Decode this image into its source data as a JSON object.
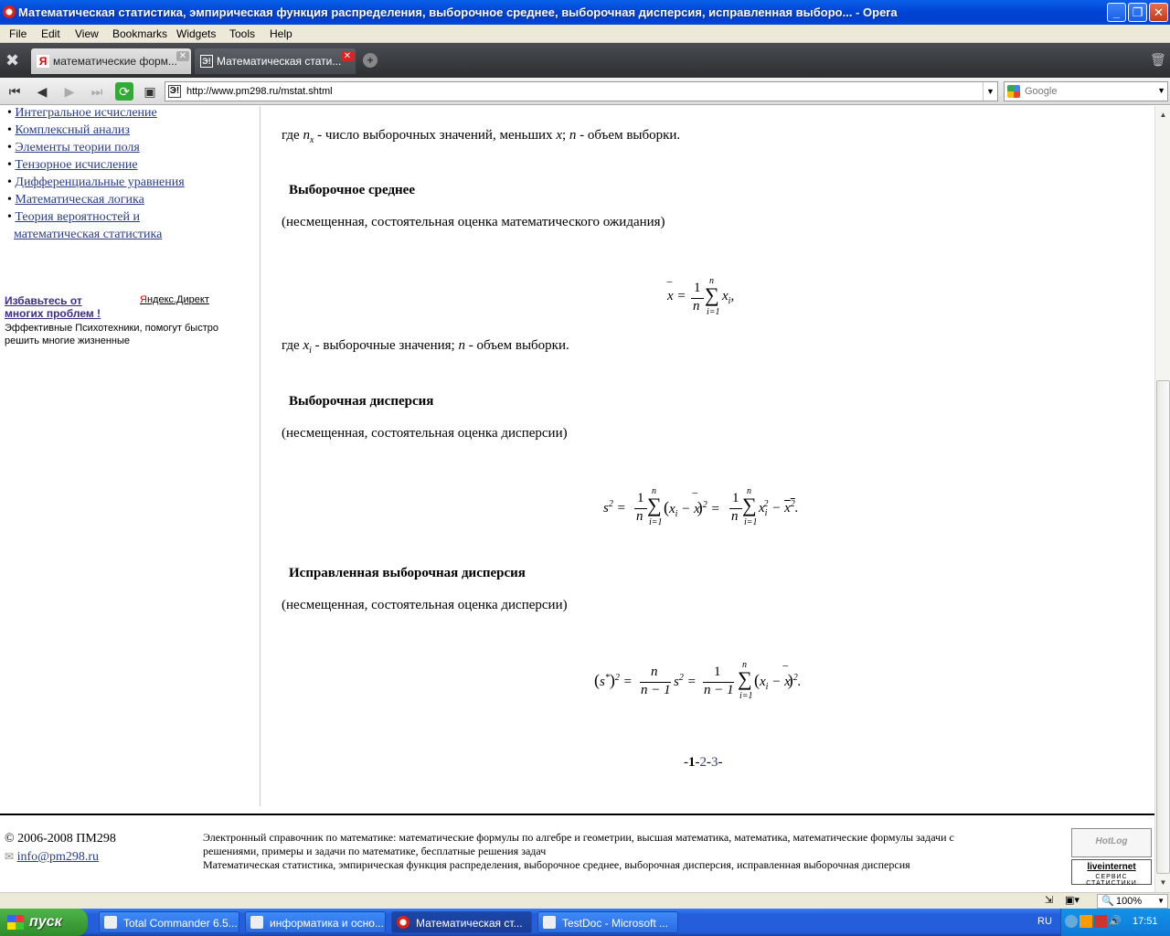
{
  "window": {
    "title": "Математическая статистика, эмпирическая функция распределения, выборочное среднее, выборочная дисперсия, исправленная выборо... - Opera",
    "min": "_",
    "max": "❐",
    "close": "✕"
  },
  "menu": [
    "File",
    "Edit",
    "View",
    "Bookmarks",
    "Widgets",
    "Tools",
    "Help"
  ],
  "tabs": [
    {
      "label": "математические форм...",
      "active": false
    },
    {
      "label": "Математическая стати...",
      "active": true
    }
  ],
  "address": {
    "url": "http://www.pm298.ru/mstat.shtml",
    "search_placeholder": "Google"
  },
  "sidebar": {
    "links": [
      "Интегральное исчисление",
      "Комплексный анализ",
      "Элементы теории поля",
      "Тензорное исчисление",
      "Дифференциальные уравнения",
      "Математическая логика",
      "Теория вероятностей и",
      "математическая статистика"
    ],
    "ad": {
      "headline": "Избавьтесь от многих проблем !",
      "direct_y": "Я",
      "direct_rest": "ндекс.Директ",
      "text": "Эффективные Психотехники, помогут быстро решить многие жизненные"
    }
  },
  "main": {
    "line1": {
      "pre": "где ",
      "nx": "n",
      "nxsub": "x",
      "mid": " - число выборочных значений, меньших ",
      "x": "x",
      "sep": "; ",
      "n": "n",
      "post": " - объем выборки."
    },
    "h1": "Выборочное среднее",
    "p1": "(несмещенная, состоятельная оценка математического ожидания)",
    "line2": {
      "pre": "где ",
      "xi": "x",
      "xisub": "i",
      "mid": " - выборочные значения; ",
      "n": "n",
      "post": " - объем выборки."
    },
    "h2": "Выборочная дисперсия",
    "p2": "(несмещенная, состоятельная оценка дисперсии)",
    "h3": "Исправленная выборочная дисперсия",
    "p3": "(несмещенная, состоятельная оценка дисперсии)",
    "pager": {
      "pre": "-",
      "current": "1",
      "sep1": "-",
      "p2": "2",
      "sep2": "-",
      "p3": "3",
      "post": "-"
    }
  },
  "footer": {
    "copyright": "© 2006-2008 ПМ298",
    "email": "info@pm298.ru",
    "desc1": "Электронный справочник по математике: математические формулы по алгебре и геометрии, высшая математика, математика, математические формулы задачи с решениями, примеры и задачи по математике, бесплатные решения задач",
    "desc2": "Математическая статистика, эмпирическая функция распределения, выборочное среднее, выборочная дисперсия, исправленная выборочная дисперсия",
    "badge1": "HotLog",
    "badge2a": "liveinternet",
    "badge2b": "СЕРВИС СТАТИСТИКИ"
  },
  "status": {
    "zoom": "100%"
  },
  "taskbar": {
    "start": "пуск",
    "items": [
      "Total Commander 6.5...",
      "информатика и осно...",
      "Математическая ст...",
      "TestDoc - Microsoft ..."
    ],
    "lang": "RU",
    "time": "17:51"
  }
}
